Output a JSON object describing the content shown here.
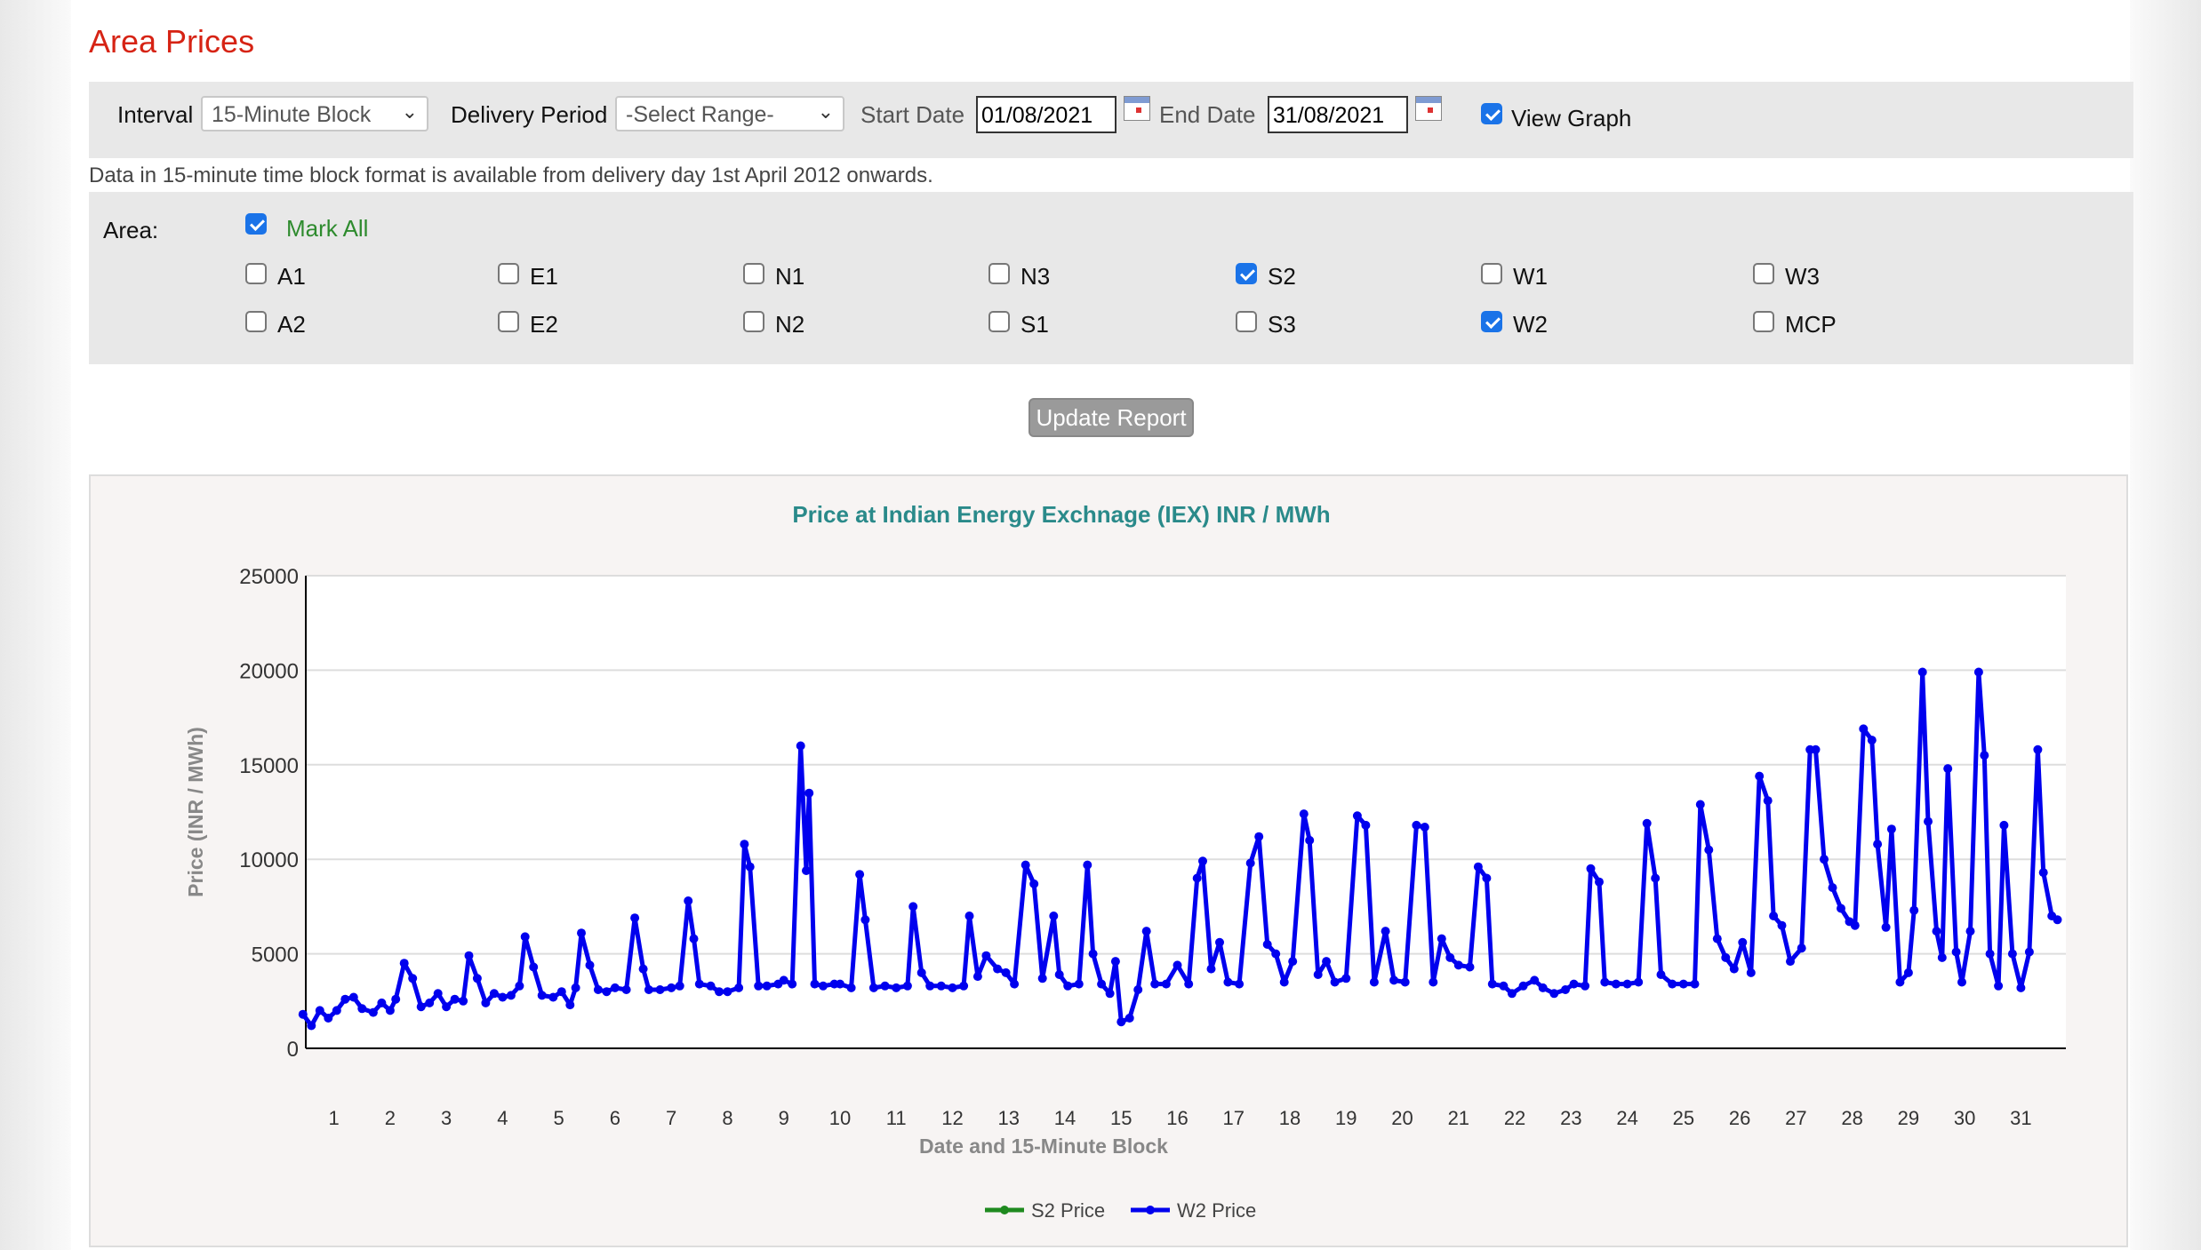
{
  "page": {
    "title": "Area Prices",
    "filters": {
      "interval_label": "Interval",
      "interval_value": "15-Minute Block",
      "delivery_label": "Delivery Period",
      "delivery_value": "-Select Range-",
      "start_label": "Start Date",
      "start_value": "01/08/2021",
      "end_label": "End Date",
      "end_value": "31/08/2021",
      "view_graph_label": "View Graph",
      "view_graph_checked": true
    },
    "note": "Data in 15-minute time block format is available from delivery day 1st April 2012 onwards.",
    "area": {
      "label": "Area:",
      "mark_all_label": "Mark All",
      "mark_all_checked": true,
      "regions": [
        {
          "label": "A1",
          "checked": false
        },
        {
          "label": "E1",
          "checked": false
        },
        {
          "label": "N1",
          "checked": false
        },
        {
          "label": "N3",
          "checked": false
        },
        {
          "label": "S2",
          "checked": true
        },
        {
          "label": "W1",
          "checked": false
        },
        {
          "label": "W3",
          "checked": false
        },
        {
          "label": "A2",
          "checked": false
        },
        {
          "label": "E2",
          "checked": false
        },
        {
          "label": "N2",
          "checked": false
        },
        {
          "label": "S1",
          "checked": false
        },
        {
          "label": "S3",
          "checked": false
        },
        {
          "label": "W2",
          "checked": true
        },
        {
          "label": "MCP",
          "checked": false
        }
      ]
    },
    "update_button": "Update Report"
  },
  "chart_data": {
    "type": "line",
    "title": "Price at Indian Energy Exchnage (IEX) INR / MWh",
    "xlabel": "Date and 15-Minute Block",
    "ylabel": "Price (INR / MWh)",
    "ylim": [
      0,
      25000
    ],
    "yticks": [
      0,
      5000,
      10000,
      15000,
      20000,
      25000
    ],
    "xlim": [
      0.5,
      31.8
    ],
    "xticks": [
      "1",
      "2",
      "3",
      "4",
      "5",
      "6",
      "7",
      "8",
      "9",
      "10",
      "11",
      "12",
      "13",
      "14",
      "15",
      "16",
      "17",
      "18",
      "19",
      "20",
      "21",
      "22",
      "23",
      "24",
      "25",
      "26",
      "27",
      "28",
      "29",
      "30",
      "31"
    ],
    "grid": true,
    "legend_position": "bottom",
    "series": [
      {
        "name": "S2 Price",
        "color": "#1f8a1f",
        "points": []
      },
      {
        "name": "W2 Price",
        "color": "#0000ee",
        "points": [
          [
            0.45,
            1800
          ],
          [
            0.6,
            1200
          ],
          [
            0.75,
            2000
          ],
          [
            0.9,
            1600
          ],
          [
            1.05,
            2000
          ],
          [
            1.2,
            2600
          ],
          [
            1.35,
            2700
          ],
          [
            1.5,
            2100
          ],
          [
            1.7,
            1900
          ],
          [
            1.85,
            2400
          ],
          [
            2.0,
            2000
          ],
          [
            2.1,
            2600
          ],
          [
            2.25,
            4500
          ],
          [
            2.4,
            3700
          ],
          [
            2.55,
            2200
          ],
          [
            2.7,
            2400
          ],
          [
            2.85,
            2900
          ],
          [
            3.0,
            2200
          ],
          [
            3.15,
            2600
          ],
          [
            3.3,
            2500
          ],
          [
            3.4,
            4900
          ],
          [
            3.55,
            3700
          ],
          [
            3.7,
            2400
          ],
          [
            3.85,
            2900
          ],
          [
            4.0,
            2700
          ],
          [
            4.15,
            2800
          ],
          [
            4.3,
            3300
          ],
          [
            4.4,
            5900
          ],
          [
            4.55,
            4300
          ],
          [
            4.7,
            2800
          ],
          [
            4.9,
            2700
          ],
          [
            5.05,
            3000
          ],
          [
            5.2,
            2300
          ],
          [
            5.3,
            3200
          ],
          [
            5.4,
            6100
          ],
          [
            5.55,
            4400
          ],
          [
            5.7,
            3100
          ],
          [
            5.85,
            3000
          ],
          [
            6.0,
            3200
          ],
          [
            6.2,
            3100
          ],
          [
            6.35,
            6900
          ],
          [
            6.5,
            4200
          ],
          [
            6.6,
            3100
          ],
          [
            6.8,
            3100
          ],
          [
            7.0,
            3200
          ],
          [
            7.15,
            3300
          ],
          [
            7.3,
            7800
          ],
          [
            7.4,
            5800
          ],
          [
            7.5,
            3400
          ],
          [
            7.7,
            3300
          ],
          [
            7.85,
            3000
          ],
          [
            8.0,
            3000
          ],
          [
            8.2,
            3200
          ],
          [
            8.3,
            10800
          ],
          [
            8.4,
            9600
          ],
          [
            8.55,
            3300
          ],
          [
            8.7,
            3300
          ],
          [
            8.9,
            3400
          ],
          [
            9.0,
            3600
          ],
          [
            9.15,
            3400
          ],
          [
            9.3,
            16000
          ],
          [
            9.4,
            9400
          ],
          [
            9.45,
            13500
          ],
          [
            9.55,
            3400
          ],
          [
            9.7,
            3300
          ],
          [
            9.9,
            3400
          ],
          [
            10.0,
            3400
          ],
          [
            10.2,
            3200
          ],
          [
            10.35,
            9200
          ],
          [
            10.45,
            6800
          ],
          [
            10.6,
            3200
          ],
          [
            10.8,
            3300
          ],
          [
            11.0,
            3200
          ],
          [
            11.2,
            3300
          ],
          [
            11.3,
            7500
          ],
          [
            11.45,
            4000
          ],
          [
            11.6,
            3300
          ],
          [
            11.8,
            3300
          ],
          [
            12.0,
            3200
          ],
          [
            12.2,
            3300
          ],
          [
            12.3,
            7000
          ],
          [
            12.45,
            3800
          ],
          [
            12.6,
            4900
          ],
          [
            12.8,
            4200
          ],
          [
            12.95,
            4000
          ],
          [
            13.1,
            3400
          ],
          [
            13.3,
            9700
          ],
          [
            13.45,
            8700
          ],
          [
            13.6,
            3700
          ],
          [
            13.8,
            7000
          ],
          [
            13.9,
            3900
          ],
          [
            14.05,
            3300
          ],
          [
            14.25,
            3400
          ],
          [
            14.4,
            9700
          ],
          [
            14.5,
            5000
          ],
          [
            14.65,
            3400
          ],
          [
            14.8,
            2900
          ],
          [
            14.9,
            4600
          ],
          [
            15.0,
            1400
          ],
          [
            15.15,
            1600
          ],
          [
            15.3,
            3100
          ],
          [
            15.45,
            6200
          ],
          [
            15.6,
            3400
          ],
          [
            15.8,
            3400
          ],
          [
            16.0,
            4400
          ],
          [
            16.2,
            3400
          ],
          [
            16.35,
            9000
          ],
          [
            16.45,
            9900
          ],
          [
            16.6,
            4200
          ],
          [
            16.75,
            5600
          ],
          [
            16.9,
            3500
          ],
          [
            17.1,
            3400
          ],
          [
            17.3,
            9800
          ],
          [
            17.45,
            11200
          ],
          [
            17.6,
            5500
          ],
          [
            17.75,
            5000
          ],
          [
            17.9,
            3500
          ],
          [
            18.05,
            4600
          ],
          [
            18.25,
            12400
          ],
          [
            18.35,
            11000
          ],
          [
            18.5,
            3900
          ],
          [
            18.65,
            4600
          ],
          [
            18.8,
            3500
          ],
          [
            19.0,
            3700
          ],
          [
            19.2,
            12300
          ],
          [
            19.35,
            11800
          ],
          [
            19.5,
            3500
          ],
          [
            19.7,
            6200
          ],
          [
            19.85,
            3600
          ],
          [
            20.05,
            3500
          ],
          [
            20.25,
            11800
          ],
          [
            20.4,
            11700
          ],
          [
            20.55,
            3500
          ],
          [
            20.7,
            5800
          ],
          [
            20.85,
            4800
          ],
          [
            21.0,
            4400
          ],
          [
            21.2,
            4300
          ],
          [
            21.35,
            9600
          ],
          [
            21.5,
            9000
          ],
          [
            21.6,
            3400
          ],
          [
            21.8,
            3300
          ],
          [
            21.95,
            2900
          ],
          [
            22.15,
            3300
          ],
          [
            22.35,
            3600
          ],
          [
            22.5,
            3200
          ],
          [
            22.7,
            2900
          ],
          [
            22.9,
            3100
          ],
          [
            23.05,
            3400
          ],
          [
            23.25,
            3300
          ],
          [
            23.35,
            9500
          ],
          [
            23.5,
            8800
          ],
          [
            23.6,
            3500
          ],
          [
            23.8,
            3400
          ],
          [
            24.0,
            3400
          ],
          [
            24.2,
            3500
          ],
          [
            24.35,
            11900
          ],
          [
            24.5,
            9000
          ],
          [
            24.6,
            3900
          ],
          [
            24.8,
            3400
          ],
          [
            25.0,
            3400
          ],
          [
            25.2,
            3400
          ],
          [
            25.3,
            12900
          ],
          [
            25.45,
            10500
          ],
          [
            25.6,
            5800
          ],
          [
            25.75,
            4800
          ],
          [
            25.9,
            4200
          ],
          [
            26.05,
            5600
          ],
          [
            26.2,
            4000
          ],
          [
            26.35,
            14400
          ],
          [
            26.5,
            13100
          ],
          [
            26.6,
            7000
          ],
          [
            26.75,
            6500
          ],
          [
            26.9,
            4600
          ],
          [
            27.1,
            5300
          ],
          [
            27.25,
            15800
          ],
          [
            27.35,
            15800
          ],
          [
            27.5,
            10000
          ],
          [
            27.65,
            8500
          ],
          [
            27.8,
            7400
          ],
          [
            27.95,
            6700
          ],
          [
            28.05,
            6500
          ],
          [
            28.2,
            16900
          ],
          [
            28.35,
            16300
          ],
          [
            28.45,
            10800
          ],
          [
            28.6,
            6400
          ],
          [
            28.7,
            11600
          ],
          [
            28.85,
            3500
          ],
          [
            29.0,
            4000
          ],
          [
            29.1,
            7300
          ],
          [
            29.25,
            19900
          ],
          [
            29.35,
            12000
          ],
          [
            29.5,
            6200
          ],
          [
            29.6,
            4800
          ],
          [
            29.7,
            14800
          ],
          [
            29.85,
            5100
          ],
          [
            29.95,
            3500
          ],
          [
            30.1,
            6200
          ],
          [
            30.25,
            19900
          ],
          [
            30.35,
            15500
          ],
          [
            30.45,
            5000
          ],
          [
            30.6,
            3300
          ],
          [
            30.7,
            11800
          ],
          [
            30.85,
            5000
          ],
          [
            31.0,
            3200
          ],
          [
            31.15,
            5100
          ],
          [
            31.3,
            15800
          ],
          [
            31.4,
            9300
          ],
          [
            31.55,
            7000
          ],
          [
            31.65,
            6800
          ]
        ]
      }
    ]
  }
}
